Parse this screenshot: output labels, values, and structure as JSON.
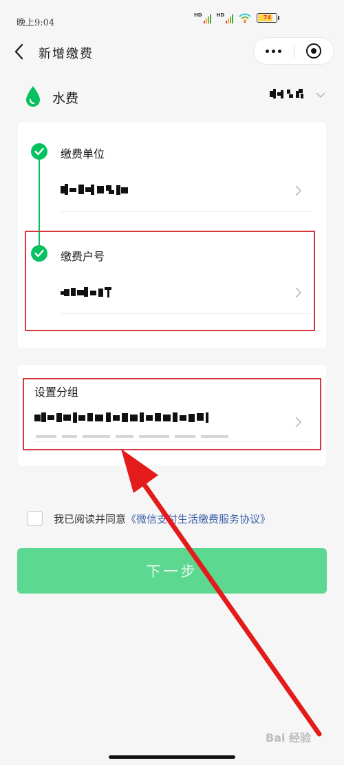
{
  "status_bar": {
    "time": "晚上9:04",
    "signal1_label": "HD",
    "signal2_label": "HD",
    "battery": "74"
  },
  "nav": {
    "title": "新增缴费",
    "back_icon": "chevron-left-icon",
    "more_icon": "more-dots-icon",
    "close_icon": "target-close-icon"
  },
  "service": {
    "name": "水费",
    "icon": "water-drop-icon"
  },
  "form": {
    "unit_label": "缴费单位",
    "account_label": "缴费户号",
    "group_label": "设置分组"
  },
  "agreement": {
    "prefix": "我已阅读并同意",
    "link": "《微信支付生活缴费服务协议》"
  },
  "next_button": "下一步",
  "watermark": "Bai 经验",
  "colors": {
    "accent": "#07c160",
    "button": "#5dd890",
    "highlight": "#d8363d",
    "link": "#3a5fa8"
  }
}
